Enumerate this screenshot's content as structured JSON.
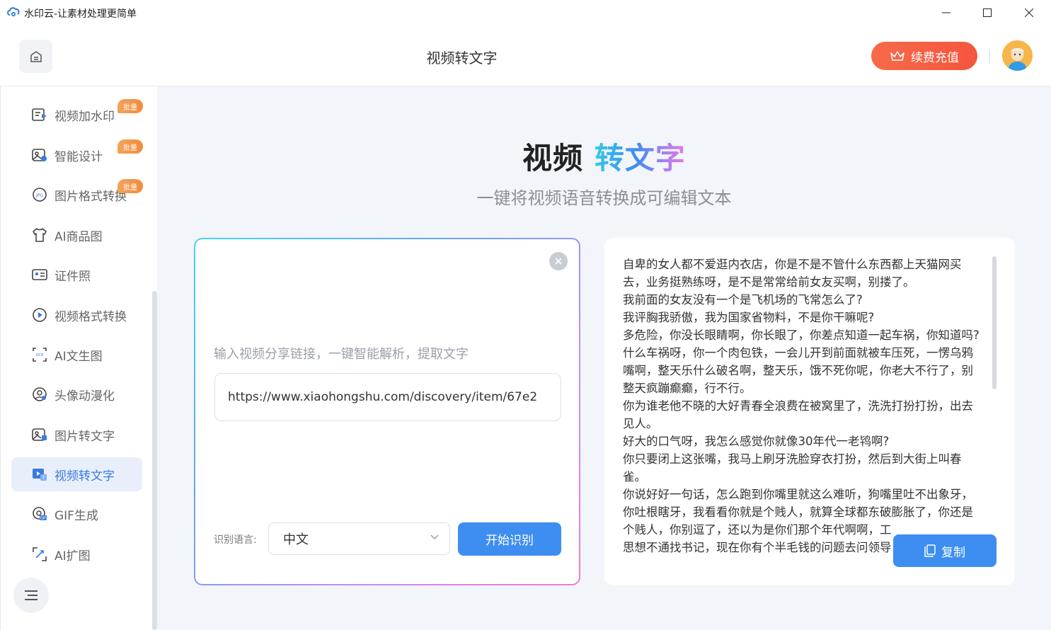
{
  "window": {
    "title": "水印云-让素材处理更简单"
  },
  "header": {
    "title": "视频转文字",
    "vip_button": "续费充值"
  },
  "sidebar": {
    "items": [
      {
        "label": "视频加水印",
        "badge": "批量",
        "icon": "video-watermark-icon"
      },
      {
        "label": "智能设计",
        "badge": "批量",
        "icon": "smart-design-icon"
      },
      {
        "label": "图片格式转换",
        "badge": "批量",
        "icon": "jpg-convert-icon"
      },
      {
        "label": "AI商品图",
        "badge": "",
        "icon": "shirt-icon"
      },
      {
        "label": "证件照",
        "badge": "",
        "icon": "id-card-icon"
      },
      {
        "label": "视频格式转换",
        "badge": "",
        "icon": "play-circle-icon"
      },
      {
        "label": "AI文生图",
        "badge": "",
        "icon": "ocr-image-icon"
      },
      {
        "label": "头像动漫化",
        "badge": "",
        "icon": "avatar-anime-icon"
      },
      {
        "label": "图片转文字",
        "badge": "",
        "icon": "image-text-icon"
      },
      {
        "label": "视频转文字",
        "badge": "",
        "icon": "video-text-icon",
        "active": true
      },
      {
        "label": "GIF生成",
        "badge": "",
        "icon": "gif-icon"
      },
      {
        "label": "AI扩图",
        "badge": "",
        "icon": "expand-image-icon"
      }
    ]
  },
  "hero": {
    "title_part1": "视频",
    "title_part2": "转文字",
    "subtitle": "一键将视频语音转换成可编辑文本"
  },
  "input_panel": {
    "hint": "输入视频分享链接，一键智能解析，提取文字",
    "link_value": "https://www.xiaohongshu.com/discovery/item/67e2",
    "language_label": "识别语言:",
    "language_value": "中文",
    "start_button": "开始识别"
  },
  "result_panel": {
    "lines": [
      "自卑的女人都不爱逛内衣店，你是不是不管什么东西都上天猫网买去，业务挺熟练呀，是不是常常给前女友买啊，别搂了。",
      "我前面的女友没有一个是飞机场的飞常怎么了?",
      "我评胸我骄傲，我为国家省物料，不是你干嘛呢?",
      "多危险，你没长眼睛啊，你长眼了，你差点知道一起车祸，你知道吗?",
      "什么车祸呀，你一个肉包铁，一会儿开到前面就被车压死，一愣乌鸦嘴啊，整天乐什么破名啊，整天乐，饿不死你呢，你老大不行了，别整天疯蹦癫癫，行不行。",
      "你为谁老他不晓的大好青春全浪费在被窝里了，洗洗打扮打扮，出去见人。",
      "好大的口气呀，我怎么感觉你就像30年代一老鸨啊?",
      "你只要闭上这张嘴，我马上刷牙洗脸穿衣打扮，然后到大街上叫春雀。",
      "你说好好一句话，怎么跑到你嘴里就这么难听，狗嘴里吐不出象牙，你吐根瞎牙，我看看你就是个贱人，就算全球都东破膨胀了，你还是个贱人，你别逗了，还以为是你们那个年代啊啊，工",
      "思想不通找书记，现在你有个半毛钱的问题去问领导"
    ],
    "copy_button": "复制"
  },
  "colors": {
    "accent": "#3d8ef0",
    "vip": "#f5553d",
    "badge": "#f08a3a"
  }
}
